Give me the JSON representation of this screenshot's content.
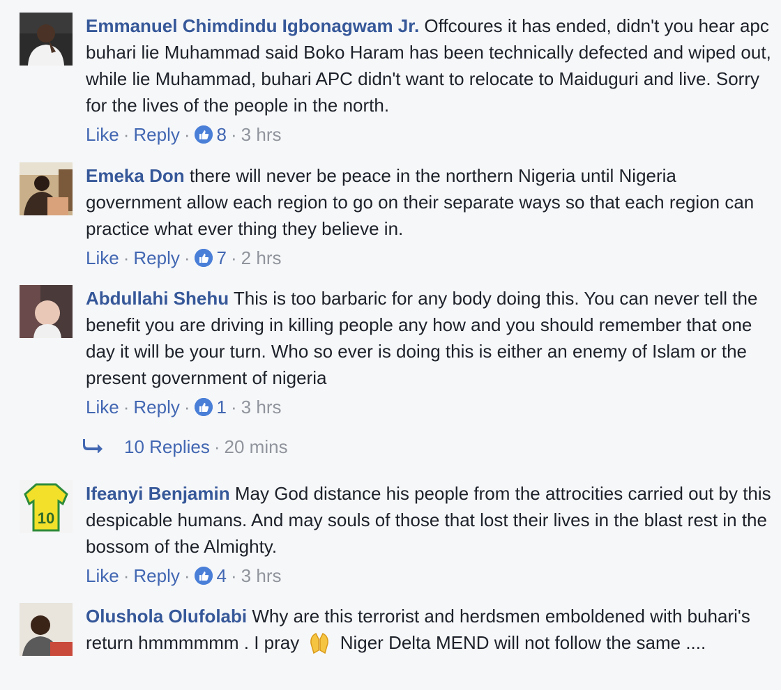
{
  "comments": [
    {
      "author": "Emmanuel Chimdindu Igbonagwam Jr.",
      "text": " Offcoures it has ended, didn't you hear apc buhari lie Muhammad said Boko Haram has been technically defected and wiped out, while lie Muhammad, buhari APC didn't want to relocate to Maiduguri and live. Sorry for the lives of the people in the north.",
      "like_label": "Like",
      "reply_label": "Reply",
      "reactions": "8",
      "time": "3 hrs"
    },
    {
      "author": "Emeka Don",
      "text": " there will never be peace in the northern Nigeria until Nigeria government allow each region to go on their separate ways so that each region can practice what ever thing they believe in.",
      "like_label": "Like",
      "reply_label": "Reply",
      "reactions": "7",
      "time": "2 hrs"
    },
    {
      "author": "Abdullahi Shehu",
      "text": " This is too barbaric for any body doing this. You can never tell the benefit you are driving in killing people any how and you should remember that one day it will be your turn. Who so ever is doing this is either an enemy of Islam or the present government of nigeria",
      "like_label": "Like",
      "reply_label": "Reply",
      "reactions": "1",
      "time": "3 hrs"
    },
    {
      "author": "Ifeanyi Benjamin",
      "text": " May God distance his people from the attrocities carried out by this despicable humans. And may souls of those that lost their lives in the blast rest in the bossom of the Almighty.",
      "like_label": "Like",
      "reply_label": "Reply",
      "reactions": "4",
      "time": "3 hrs"
    },
    {
      "author": "Olushola Olufolabi",
      "text_before": " Why are this terrorist and herdsmen emboldened with buhari's return hmmmmmm . I pray",
      "text_after": " Niger Delta MEND will not follow the same ...."
    }
  ],
  "replies_thread": {
    "label": "10 Replies",
    "time": "20 mins"
  },
  "jersey_number": "10",
  "icons": {
    "reply_arrow": "reply-arrow-icon",
    "like": "thumbs-up-icon",
    "emoji": "praying-hands-emoji"
  },
  "colors": {
    "author": "#365899",
    "link": "#4267b2",
    "meta": "#90949c",
    "like_badge": "#4a7fd8",
    "background": "#f6f7f9"
  }
}
